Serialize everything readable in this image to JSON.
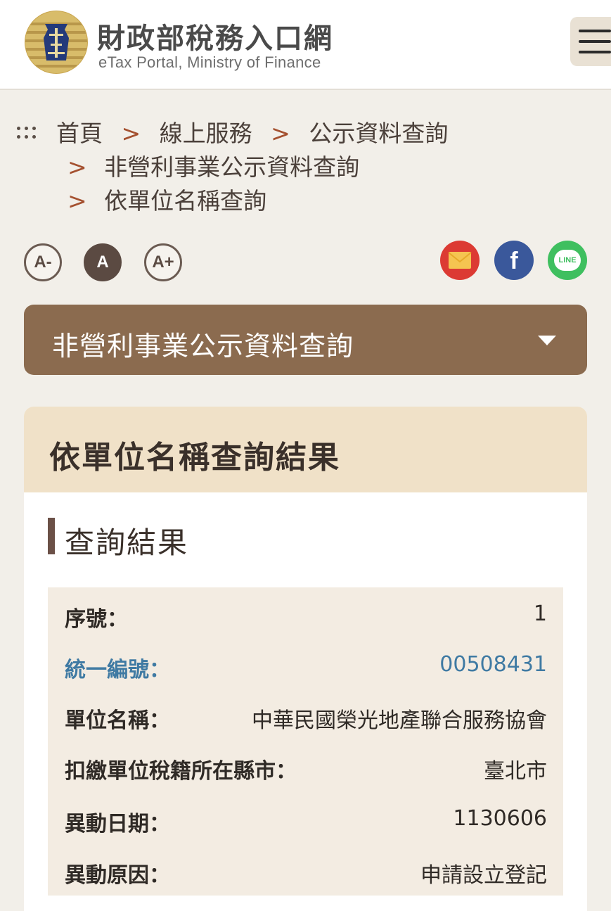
{
  "header": {
    "title": "財政部稅務入口網",
    "subtitle": "eTax Portal, Ministry of Finance",
    "menu_icon": "hamburger-menu-icon"
  },
  "breadcrumb": {
    "items": [
      "首頁",
      "線上服務",
      "公示資料查詢",
      "非營利事業公示資料查詢",
      "依單位名稱查詢"
    ],
    "separator": ">"
  },
  "font_size": {
    "small": "A-",
    "normal": "A",
    "large": "A+"
  },
  "share": {
    "mail": "envelope-icon",
    "facebook_glyph": "f",
    "line_glyph": "LINE"
  },
  "dropdown": {
    "label": "非營利事業公示資料查詢"
  },
  "panel": {
    "title": "依單位名稱查詢結果",
    "section_title": "查詢結果"
  },
  "result": {
    "rows": [
      {
        "label": "序號：",
        "value": "1"
      },
      {
        "label": "統一編號：",
        "value": "00508431"
      },
      {
        "label": "單位名稱：",
        "value": "中華民國榮光地產聯合服務協會"
      },
      {
        "label": "扣繳單位稅籍所在縣市：",
        "value": "臺北市"
      },
      {
        "label": "異動日期：",
        "value": "1130606"
      },
      {
        "label": "異動原因：",
        "value": "申請設立登記"
      }
    ]
  },
  "colors": {
    "accent_brown": "#8b6b4f",
    "panel_header": "#f0e1c8",
    "card_bg": "#f3ece2",
    "link_blue": "#3f7aa3"
  }
}
